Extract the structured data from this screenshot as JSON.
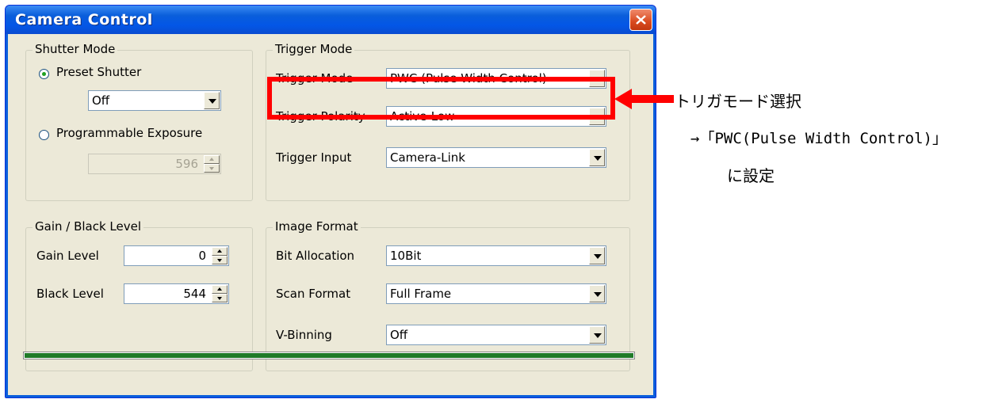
{
  "window": {
    "title": "Camera Control",
    "close_icon": "close-icon"
  },
  "shutter_mode": {
    "legend": "Shutter Mode",
    "preset_label": "Preset Shutter",
    "preset_selected": true,
    "preset_value": "Off",
    "programmable_label": "Programmable Exposure",
    "programmable_selected": false,
    "exposure_value": "596"
  },
  "gain_black": {
    "legend": "Gain / Black Level",
    "gain_label": "Gain Level",
    "gain_value": "0",
    "black_label": "Black Level",
    "black_value": "544"
  },
  "trigger_mode": {
    "legend": "Trigger Mode",
    "mode_label": "Trigger Mode",
    "mode_value": "PWC (Pulse Width Control)",
    "polarity_label": "Trigger Polarity",
    "polarity_value": "Active-Low",
    "input_label": "Trigger Input",
    "input_value": "Camera-Link"
  },
  "image_format": {
    "legend": "Image Format",
    "bit_label": "Bit Allocation",
    "bit_value": "10Bit",
    "scan_label": "Scan Format",
    "scan_value": "Full Frame",
    "vbin_label": "V-Binning",
    "vbin_value": "Off"
  },
  "progress": {
    "value": 1.0,
    "color": "#1f7a28"
  },
  "annotation": {
    "line1": "トリガモード選択",
    "line2": "→「PWC(Pulse Width Control)」",
    "line3": "に設定",
    "color": "#ff0000"
  }
}
